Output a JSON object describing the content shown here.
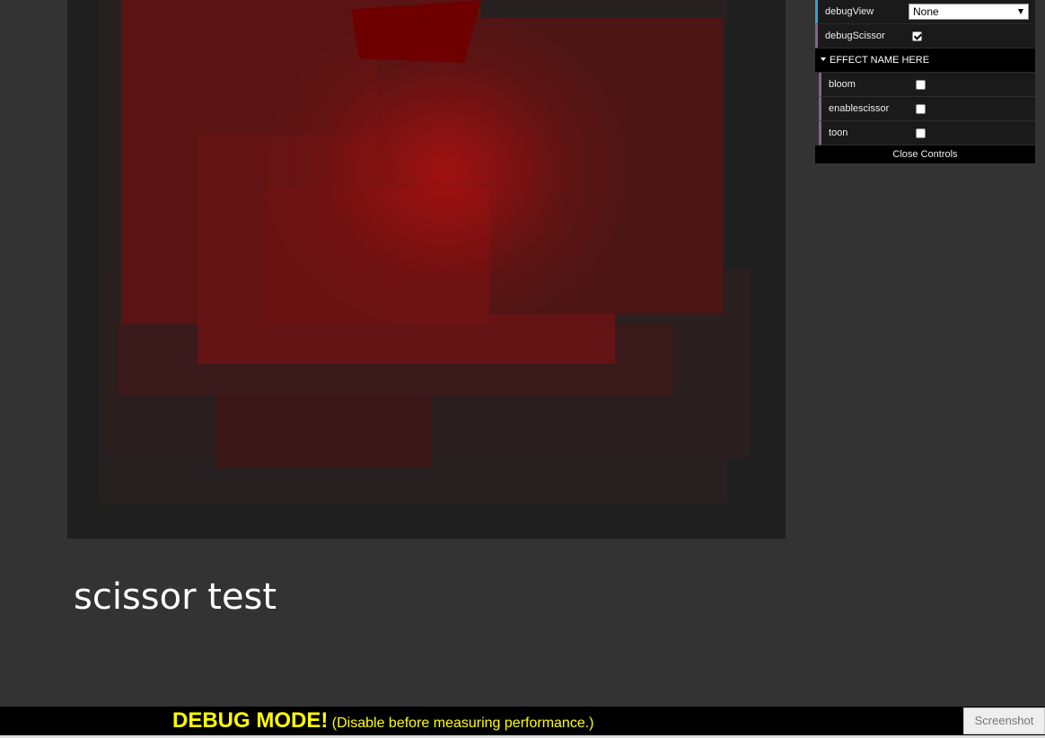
{
  "scene": {
    "title": "scissor test"
  },
  "gui": {
    "debug_view": {
      "label": "debugView",
      "value": "None"
    },
    "debug_scissor": {
      "label": "debugScissor",
      "checked": true
    },
    "folder": {
      "title": "EFFECT NAME HERE",
      "items": [
        {
          "label": "bloom",
          "checked": false
        },
        {
          "label": "enablescissor",
          "checked": false
        },
        {
          "label": "toon",
          "checked": false
        }
      ]
    },
    "close_label": "Close Controls"
  },
  "debug_bar": {
    "strong": "DEBUG MODE!",
    "note": "(Disable before measuring performance.)",
    "screenshot_label": "Screenshot"
  },
  "colors": {
    "page_background": "#333333",
    "canvas_background": "#1f1f1f",
    "scene_red": "#9a0c0c",
    "debug_text": "#ffff00",
    "gui_blue_accent": "#2fa1d6",
    "gui_purple_accent": "#806787"
  }
}
